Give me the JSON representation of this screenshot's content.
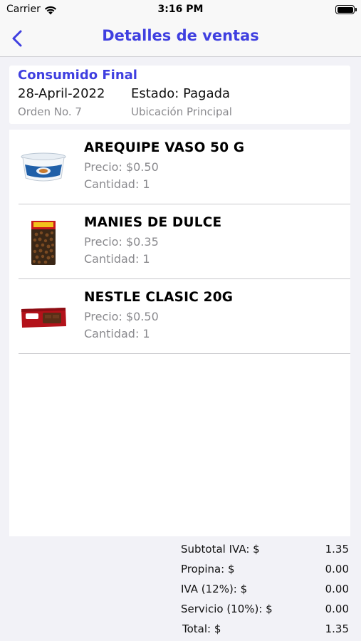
{
  "status_bar": {
    "carrier": "Carrier",
    "time": "3:16 PM",
    "battery_level": 1.0
  },
  "nav": {
    "title": "Detalles de ventas",
    "back_icon": "chevron-left-icon"
  },
  "header": {
    "customer": "Consumido Final",
    "date": "28-April-2022",
    "status": "Estado: Pagada",
    "order": "Orden No. 7",
    "location": "Ubicación Principal"
  },
  "items": [
    {
      "name": "AREQUIPE VASO 50 G",
      "price": "Precio: $0.50",
      "quantity": "Cantidad: 1",
      "image": "arequipe-cup-image"
    },
    {
      "name": "MANIES DE DULCE",
      "price": "Precio: $0.35",
      "quantity": "Cantidad: 1",
      "image": "peanut-bag-image"
    },
    {
      "name": "NESTLE CLASIC 20G",
      "price": "Precio: $0.50",
      "quantity": "Cantidad: 1",
      "image": "chocolate-bar-image"
    }
  ],
  "totals": [
    {
      "label": "Subtotal IVA: $",
      "value": "1.35"
    },
    {
      "label": "Propina: $",
      "value": "0.00"
    },
    {
      "label": "IVA (12%): $",
      "value": "0.00"
    },
    {
      "label": "Servicio (10%): $",
      "value": "0.00"
    },
    {
      "label": "Total: $",
      "value": "1.35"
    }
  ],
  "colors": {
    "accent": "#3f3fe0",
    "secondary_text": "#8a8a8e",
    "background": "#f2f2f7"
  }
}
